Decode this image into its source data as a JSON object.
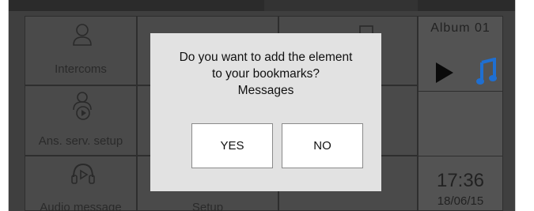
{
  "tiles": {
    "intercoms": "Intercoms",
    "answer_setup": "Ans. serv. setup",
    "audio_message": "Audio message",
    "setup": "Setup"
  },
  "side": {
    "album": "Album 01",
    "time": "17:36",
    "date": "18/06/15"
  },
  "icons": {
    "intercoms": "person-icon",
    "answer_setup": "answering-machine-icon",
    "audio_message": "headset-play-icon",
    "play": "play-icon",
    "music": "music-note-icon"
  },
  "colors": {
    "music_note": "#1f6fd1"
  },
  "dialog": {
    "line1": "Do you want to add the element",
    "line2": "to your bookmarks?",
    "line3": "Messages",
    "yes": "YES",
    "no": "NO"
  }
}
